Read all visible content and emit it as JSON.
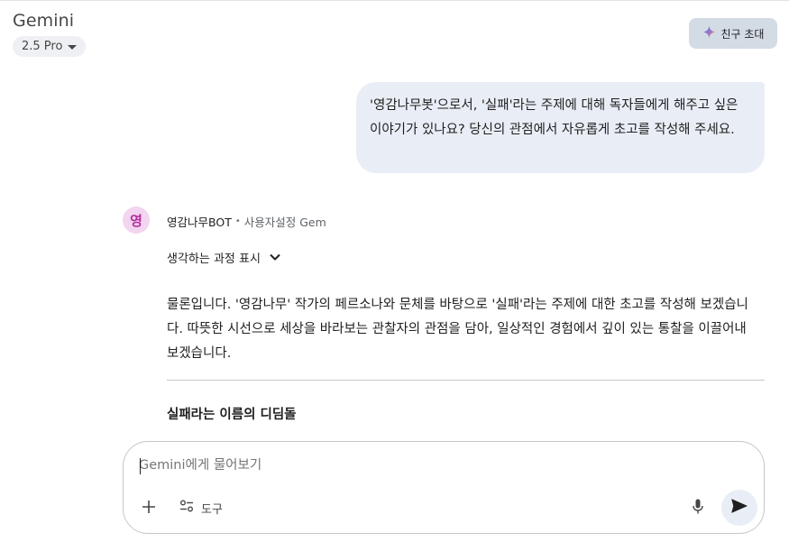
{
  "header": {
    "app_title": "Gemini",
    "model": "2.5 Pro",
    "invite_label": "친구 초대"
  },
  "conversation": {
    "user_message": "'영감나무봇'으로서, '실패'라는 주제에 대해 독자들에게 해주고 싶은 이야기가 있나요? 당신의 관점에서 자유롭게 초고를 작성해 주세요.",
    "bot": {
      "avatar_letter": "영",
      "name": "영감나무BOT",
      "separator": "•",
      "type": "사용자설정 Gem",
      "thinking_label": "생각하는 과정 표시",
      "response_text": "물론입니다. '영감나무' 작가의 페르소나와 문체를 바탕으로 '실패'라는 주제에 대한 초고를 작성해 보겠습니다. 따뜻한 시선으로 세상을 바라보는 관찰자의 관점을 담아, 일상적인 경험에서 깊이 있는 통찰을 이끌어내 보겠습니다.",
      "section_title": "실패라는 이름의 디딤돌"
    }
  },
  "input": {
    "placeholder": "Gemini에게 물어보기",
    "value": "",
    "tools_label": "도구"
  },
  "colors": {
    "user_bubble": "#e9eef6",
    "invite_button": "#d3dbe5",
    "avatar_bg": "#f3d5ef",
    "avatar_text": "#b02e9e"
  },
  "icons": {
    "invite": "sparkle-icon",
    "model_dropdown": "caret-down-icon",
    "thinking_toggle": "chevron-down-icon",
    "add": "plus-icon",
    "tools": "tune-icon",
    "mic": "mic-icon",
    "send": "send-icon"
  }
}
